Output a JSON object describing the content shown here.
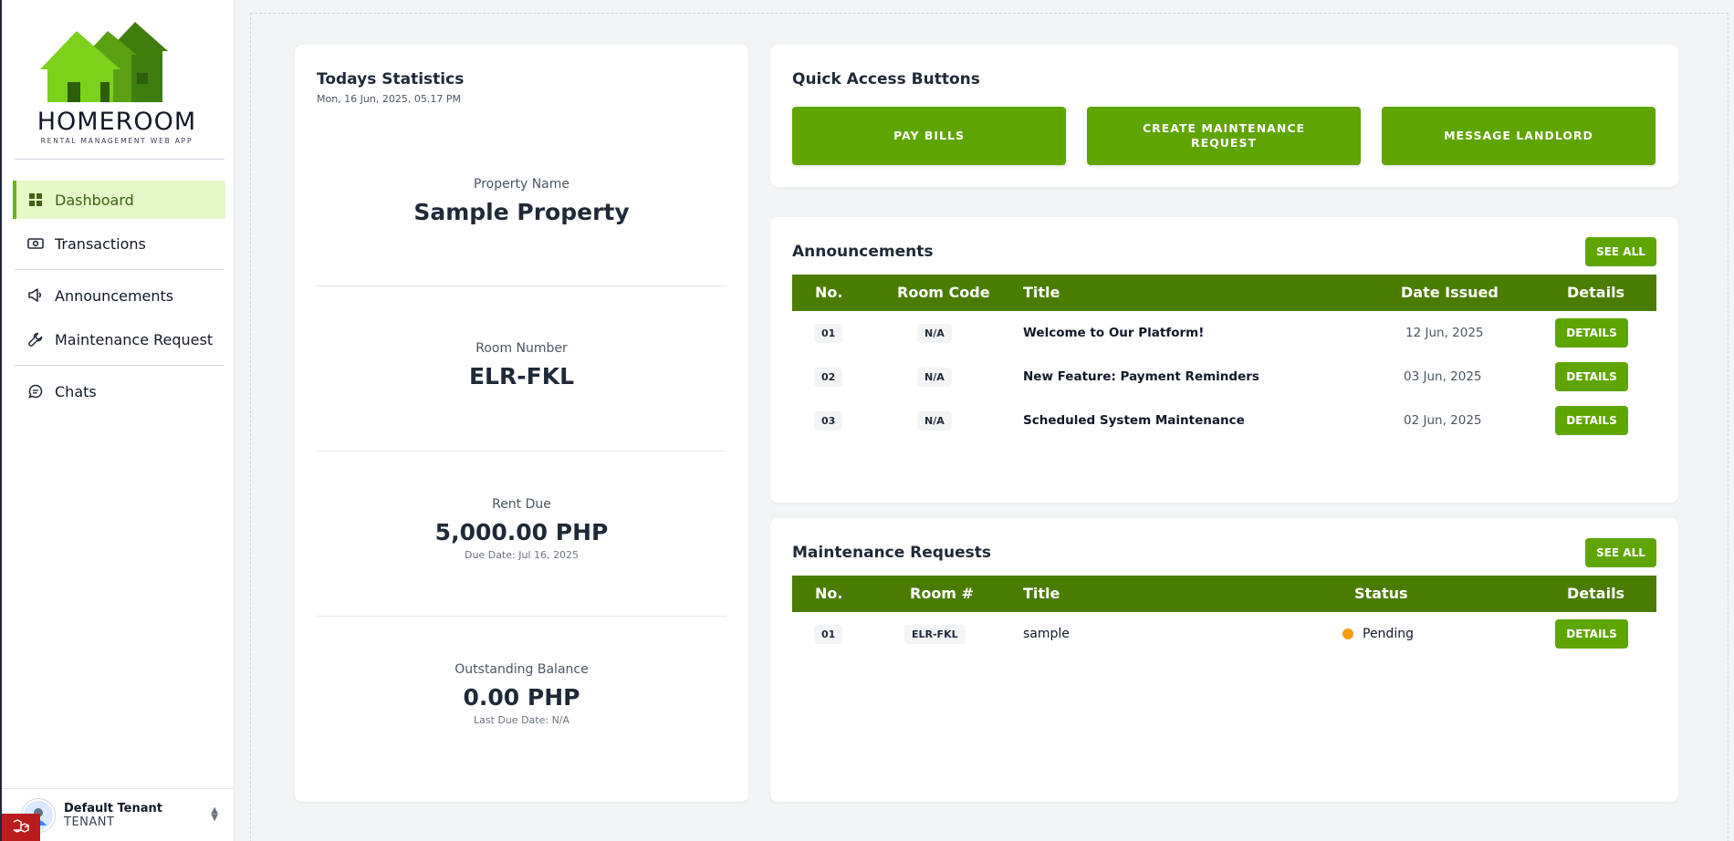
{
  "sidebar": {
    "logo": {
      "title": "HOMEROOM",
      "subtitle": "RENTAL MANAGEMENT WEB APP"
    },
    "items": [
      {
        "label": "Dashboard",
        "icon": "dashboard-icon",
        "active": true
      },
      {
        "label": "Transactions",
        "icon": "money-icon"
      },
      {
        "label": "Announcements",
        "icon": "megaphone-icon"
      },
      {
        "label": "Maintenance Request",
        "icon": "wrench-icon"
      },
      {
        "label": "Chats",
        "icon": "chat-icon"
      }
    ],
    "user": {
      "name": "Default Tenant",
      "role": "TENANT"
    }
  },
  "stats": {
    "title": "Todays Statistics",
    "date": "Mon, 16 Jun, 2025, 05.17 PM",
    "property_label": "Property Name",
    "property_value": "Sample Property",
    "room_label": "Room Number",
    "room_value": "ELR-FKL",
    "rent_label": "Rent Due",
    "rent_value": "5,000.00 PHP",
    "rent_note": "Due Date: Jul 16, 2025",
    "balance_label": "Outstanding Balance",
    "balance_value": "0.00 PHP",
    "balance_note": "Last Due Date: N/A"
  },
  "quick": {
    "title": "Quick Access Buttons",
    "pay_bills": "PAY BILLS",
    "create_request_line1": "CREATE MAINTENANCE",
    "create_request_line2": "REQUEST",
    "message_landlord": "MESSAGE LANDLORD"
  },
  "announcements": {
    "title": "Announcements",
    "see_all": "SEE ALL",
    "headers": {
      "no": "No.",
      "room_code": "Room Code",
      "title": "Title",
      "date": "Date Issued",
      "details": "Details"
    },
    "rows": [
      {
        "no": "01",
        "room_code": "N/A",
        "title": "Welcome to Our Platform!",
        "date": "12 Jun, 2025",
        "details": "DETAILS"
      },
      {
        "no": "02",
        "room_code": "N/A",
        "title": "New Feature: Payment Reminders",
        "date": "03 Jun, 2025",
        "details": "DETAILS"
      },
      {
        "no": "03",
        "room_code": "N/A",
        "title": "Scheduled System Maintenance",
        "date": "02 Jun, 2025",
        "details": "DETAILS"
      }
    ]
  },
  "maintenance": {
    "title": "Maintenance Requests",
    "see_all": "SEE ALL",
    "headers": {
      "no": "No.",
      "room": "Room #",
      "title": "Title",
      "status": "Status",
      "details": "Details"
    },
    "rows": [
      {
        "no": "01",
        "room": "ELR-FKL",
        "title": "sample",
        "status": "Pending",
        "details": "DETAILS"
      }
    ]
  },
  "colors": {
    "accent": "#5ea500",
    "header": "#4a7c00",
    "active_bg": "#e6f7c8",
    "pending": "#f59e0b"
  }
}
